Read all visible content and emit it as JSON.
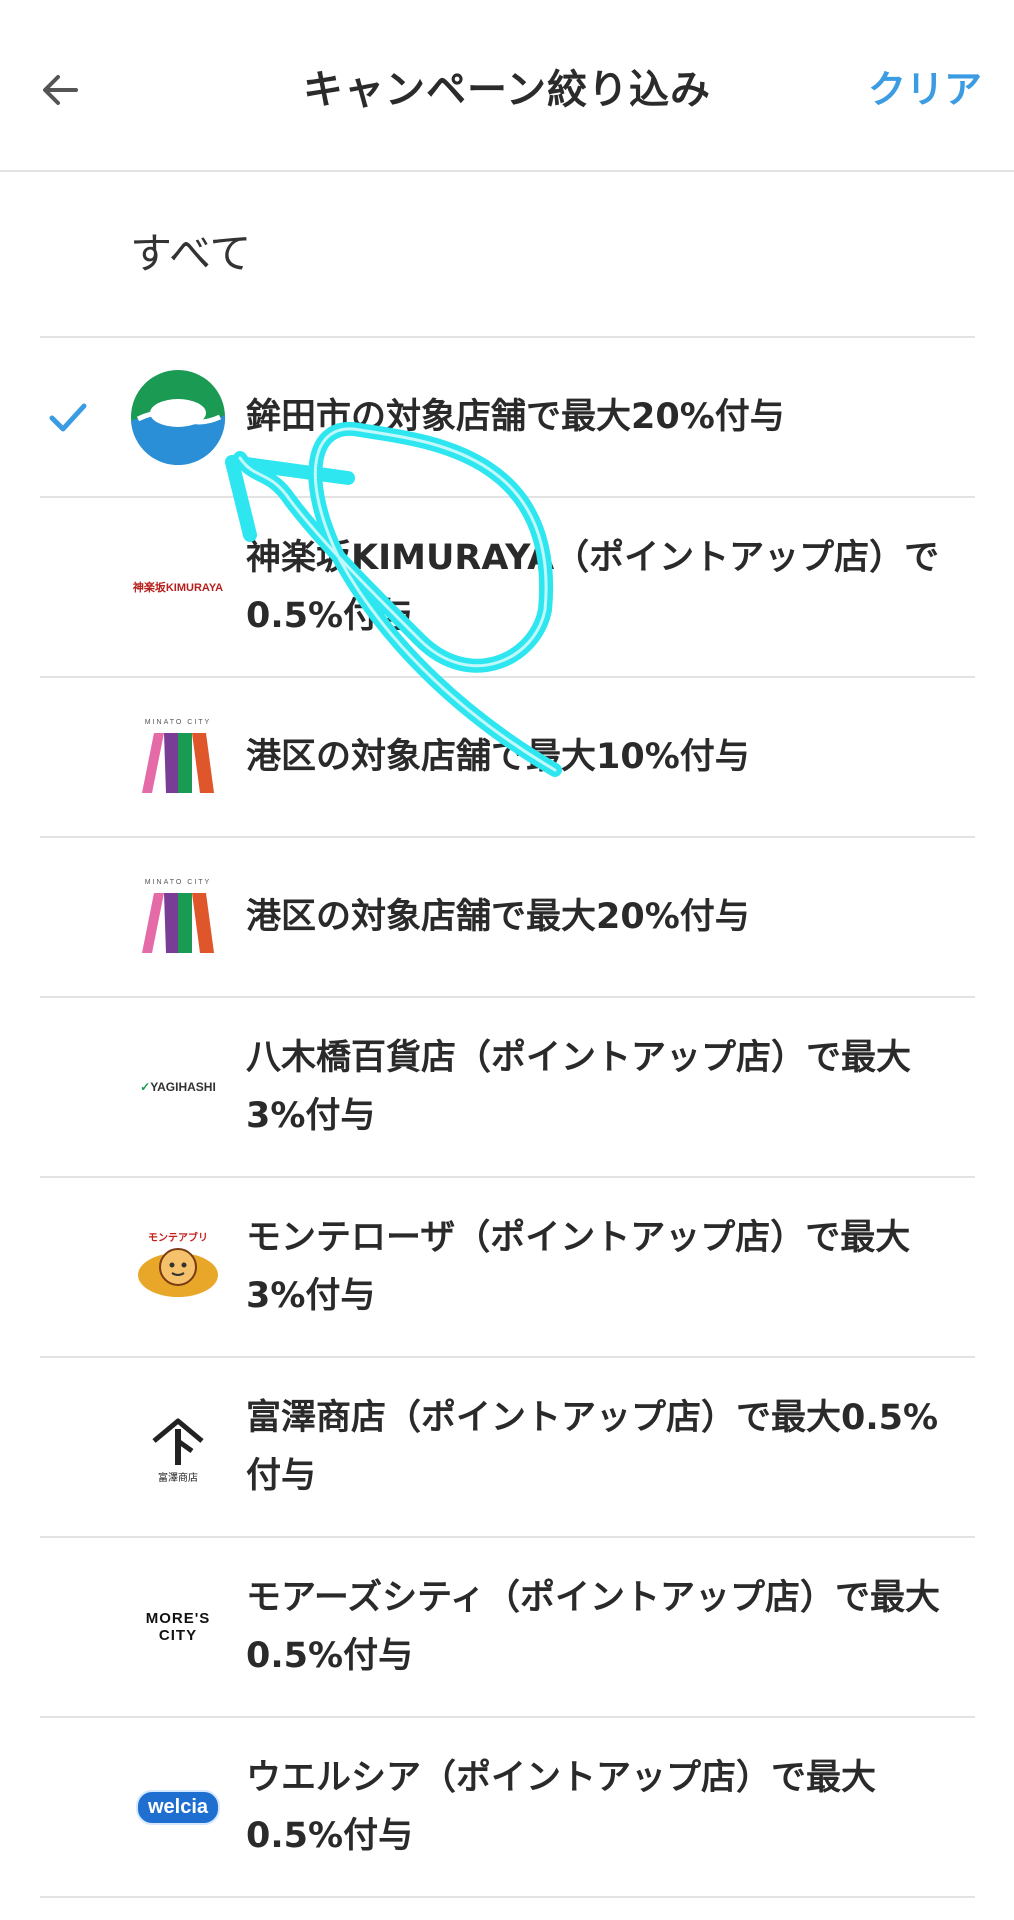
{
  "header": {
    "title": "キャンペーン絞り込み",
    "clear_label": "クリア"
  },
  "all_option": {
    "label": "すべて"
  },
  "campaigns": [
    {
      "label": "鉾田市の対象店舗で最大20%付与",
      "selected": true,
      "logo": "hokota-city-logo"
    },
    {
      "label": "神楽坂KIMURAYA（ポイントアップ店）で0.5%付与",
      "selected": false,
      "logo": "kimuraya-logo",
      "logo_text": "神楽坂KIMURAYA"
    },
    {
      "label": "港区の対象店舗で最大10%付与",
      "selected": false,
      "logo": "minato-city-logo",
      "logo_text": "MINATO CITY"
    },
    {
      "label": "港区の対象店舗で最大20%付与",
      "selected": false,
      "logo": "minato-city-logo",
      "logo_text": "MINATO CITY"
    },
    {
      "label": "八木橋百貨店（ポイントアップ店）で最大3%付与",
      "selected": false,
      "logo": "yagihashi-logo",
      "logo_text": "YAGIHASHI"
    },
    {
      "label": "モンテローザ（ポイントアップ店）で最大3%付与",
      "selected": false,
      "logo": "monterosa-logo",
      "logo_text": "モンテアブリ"
    },
    {
      "label": "富澤商店（ポイントアップ店）で最大0.5%付与",
      "selected": false,
      "logo": "tomizawa-logo",
      "logo_text": "富澤商店"
    },
    {
      "label": "モアーズシティ（ポイントアップ店）で最大0.5%付与",
      "selected": false,
      "logo": "mores-city-logo",
      "logo_text": "MORE'S CITY"
    },
    {
      "label": "ウエルシア（ポイントアップ店）で最大0.5%付与",
      "selected": false,
      "logo": "welcia-logo",
      "logo_text": "welcia"
    }
  ],
  "colors": {
    "accent": "#3b9ce3",
    "annotation": "#2ee6f0",
    "divider": "#e3e3e3"
  }
}
